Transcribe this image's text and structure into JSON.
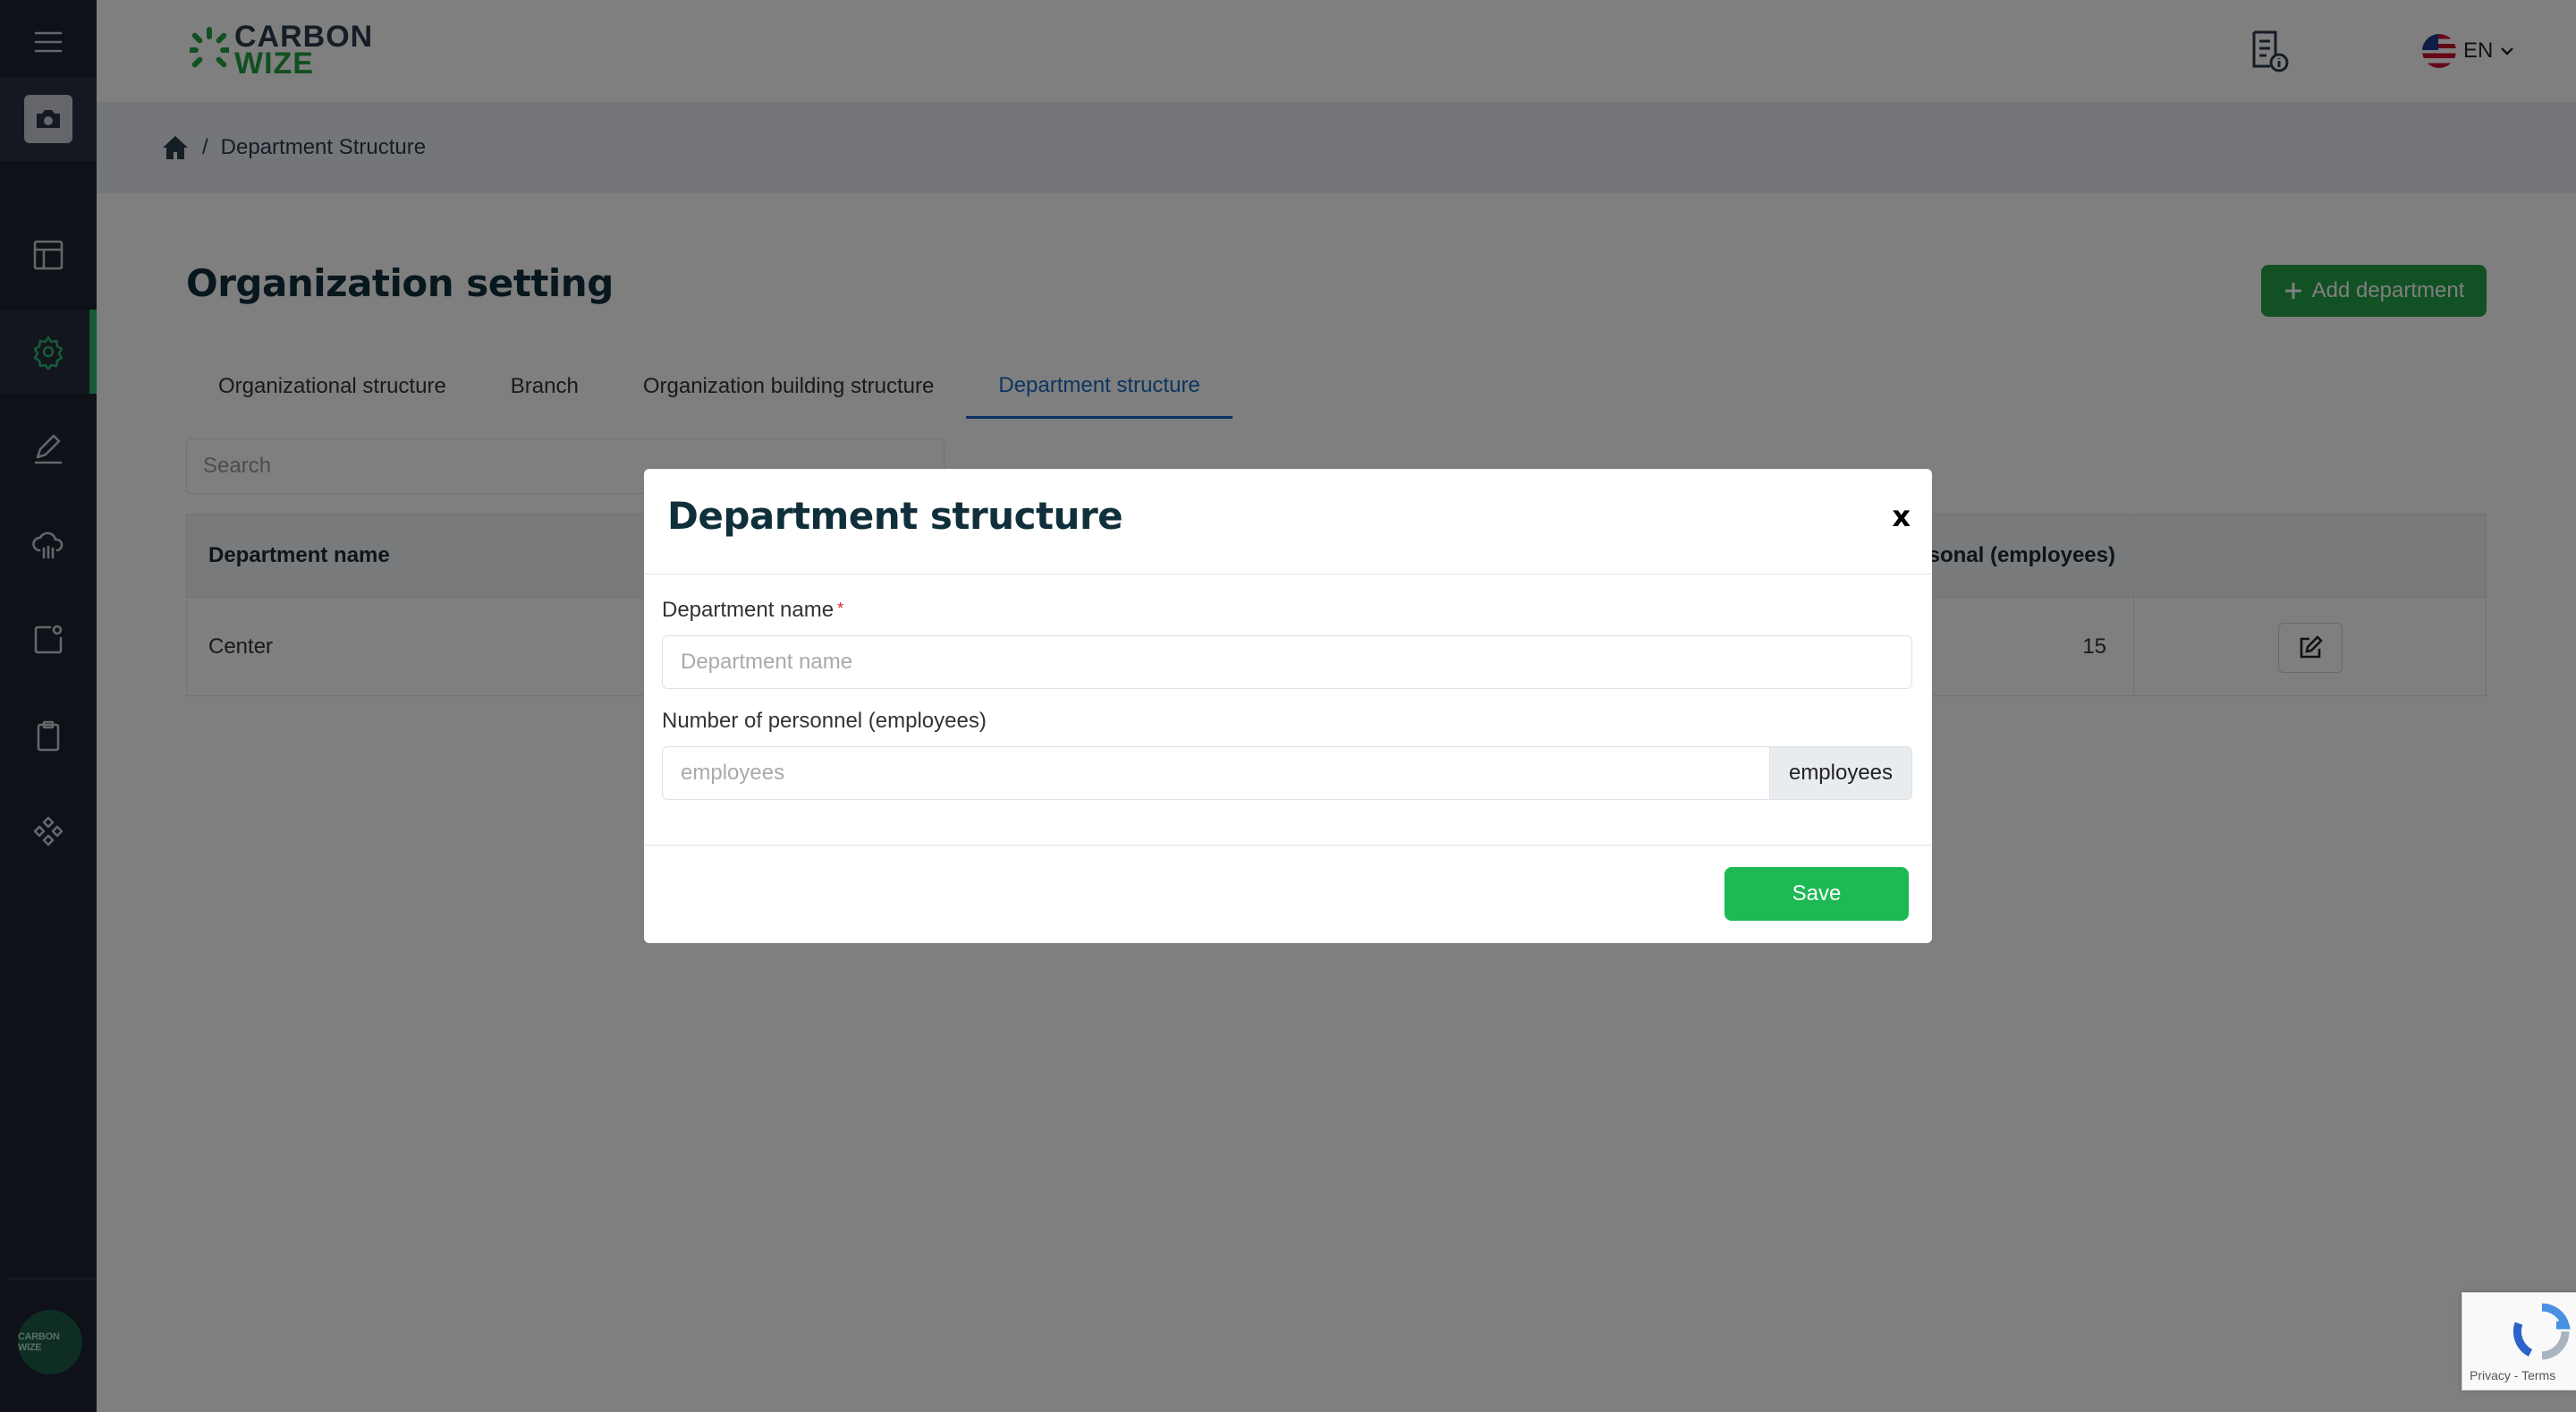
{
  "brand": {
    "line1": "CARBON",
    "line2": "WIZE",
    "avatar_text": "CARBON WIZE"
  },
  "header": {
    "language": "EN"
  },
  "breadcrumb": {
    "current": "Department Structure"
  },
  "page": {
    "title": "Organization setting",
    "add_button": "Add department",
    "tabs": [
      {
        "label": "Organizational structure",
        "active": false
      },
      {
        "label": "Branch",
        "active": false
      },
      {
        "label": "Organization building structure",
        "active": false
      },
      {
        "label": "Department structure",
        "active": true
      }
    ],
    "search_placeholder": "Search"
  },
  "table": {
    "columns": [
      "Department name",
      "sonal (employees)"
    ],
    "rows": [
      {
        "name": "Center",
        "employees": "15"
      }
    ]
  },
  "modal": {
    "title": "Department structure",
    "close": "x",
    "field1_label": "Department name",
    "field1_required": "*",
    "field1_placeholder": "Department name",
    "field2_label": "Number of personnel (employees)",
    "field2_placeholder": "employees",
    "field2_addon": "employees",
    "save": "Save"
  },
  "recaptcha": {
    "text": "Privacy - Terms"
  },
  "colors": {
    "primary_green": "#24a249",
    "save_green": "#1db954",
    "tab_active": "#1b6bc2",
    "sidebar_bg": "#1d2330"
  }
}
